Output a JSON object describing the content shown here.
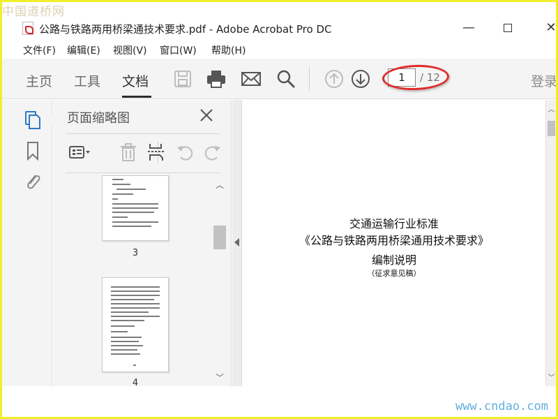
{
  "watermarks": {
    "top_left": "中国道桥网",
    "bottom_right": "www.cndao.com"
  },
  "window": {
    "title": "公路与铁路两用桥梁通技术要求.pdf - Adobe Acrobat Pro DC",
    "app_icon": "pdf-file-icon",
    "controls": {
      "minimize": "—",
      "close": "✕"
    }
  },
  "menu": {
    "items": [
      {
        "label": "文件(F)"
      },
      {
        "label": "编辑(E)"
      },
      {
        "label": "视图(V)"
      },
      {
        "label": "窗口(W)"
      },
      {
        "label": "帮助(H)"
      }
    ]
  },
  "toolbar": {
    "tabs": [
      {
        "label": "主页",
        "active": false
      },
      {
        "label": "工具",
        "active": false
      },
      {
        "label": "文档",
        "active": true
      }
    ],
    "tools": [
      "save-icon",
      "print-icon",
      "email-icon",
      "search-icon",
      "page-up-icon",
      "page-down-icon"
    ],
    "page_current": "1",
    "page_total": "/ 12",
    "login_label": "登录"
  },
  "rail": {
    "icons": [
      "page-thumbnails-icon",
      "bookmark-icon",
      "attachment-icon"
    ]
  },
  "thumbnail_panel": {
    "title": "页面缩略图",
    "tools": [
      "options-icon",
      "delete-icon",
      "insert-page-icon",
      "rotate-left-icon",
      "rotate-right-icon"
    ],
    "pages": [
      {
        "label": "3"
      },
      {
        "label": "4"
      }
    ]
  },
  "document": {
    "line1": "交通运输行业标准",
    "line2": "《公路与铁路两用桥梁通用技术要求》",
    "line3": "编制说明",
    "line4": "（征求意见稿）"
  },
  "colors": {
    "frame": "#f1ee2b",
    "annotation": "#e12b2b",
    "toolbar_bg": "#f4f4f4",
    "accent_blue": "#2b79c8"
  }
}
